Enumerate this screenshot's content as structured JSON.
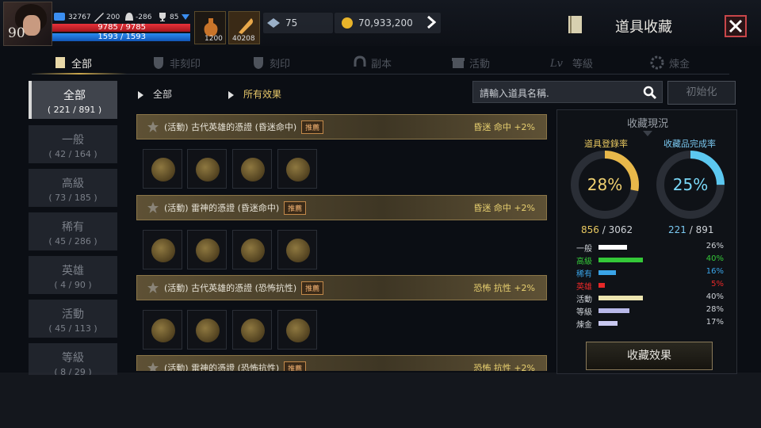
{
  "header": {
    "level": "90",
    "hp": "9785 / 9785",
    "mp": "1593 / 1593",
    "power": "32767",
    "stat_a": "200",
    "stat_b": "-286",
    "stat_c": "85",
    "potion_count": "1200",
    "item_count": "40208",
    "gem": "75",
    "gold": "70,933,200",
    "title": "道具收藏"
  },
  "tabs": [
    {
      "label": "全部"
    },
    {
      "label": "非刻印"
    },
    {
      "label": "刻印"
    },
    {
      "label": "副本"
    },
    {
      "label": "活動"
    },
    {
      "label": "等級"
    },
    {
      "label": "煉金"
    }
  ],
  "categories": [
    {
      "label": "全部",
      "count": "( 221 / 891 )"
    },
    {
      "label": "一般",
      "count": "( 42 / 164 )"
    },
    {
      "label": "高級",
      "count": "( 73 / 185 )"
    },
    {
      "label": "稀有",
      "count": "( 45 / 286 )"
    },
    {
      "label": "英雄",
      "count": "( 4 / 90 )"
    },
    {
      "label": "活動",
      "count": "( 45 / 113 )"
    },
    {
      "label": "等級",
      "count": "( 8 / 29 )"
    }
  ],
  "breadcrumb": {
    "first": "全部",
    "second": "所有效果"
  },
  "search": {
    "placeholder": "請輸入道具名稱."
  },
  "init_label": "初始化",
  "rows": [
    {
      "name": "(活動) 古代英雄的憑證 (昏迷命中)",
      "badge": "推薦",
      "effect": "昏迷 命中 +2%"
    },
    {
      "name": "(活動) 雷神的憑證 (昏迷命中)",
      "badge": "推薦",
      "effect": "昏迷 命中 +2%"
    },
    {
      "name": "(活動) 古代英雄的憑證 (恐怖抗性)",
      "badge": "推薦",
      "effect": "恐怖 抗性 +2%"
    },
    {
      "name": "(活動) 雷神的憑證 (恐怖抗性)",
      "badge": "推薦",
      "effect": "恐怖 抗性 +2%"
    }
  ],
  "panel": {
    "title": "收藏現況",
    "ring1": {
      "label": "道具登錄率",
      "pct": "28%",
      "value": 0.28,
      "count": "856",
      "total": "/ 3062",
      "color": "#e8b84a"
    },
    "ring2": {
      "label": "收藏品完成率",
      "pct": "25%",
      "value": 0.25,
      "count": "221",
      "total": "/ 891",
      "color": "#5cc8f0"
    },
    "stats": [
      {
        "label": "一般",
        "pct": "26%",
        "value": 0.26,
        "color": "#ffffff"
      },
      {
        "label": "高級",
        "pct": "40%",
        "value": 0.4,
        "color": "#34c838"
      },
      {
        "label": "稀有",
        "pct": "16%",
        "value": 0.16,
        "color": "#3aa4e8"
      },
      {
        "label": "英雄",
        "pct": "5%",
        "value": 0.05,
        "color": "#e82828"
      },
      {
        "label": "活動",
        "pct": "40%",
        "value": 0.4,
        "color": "#ece4b0"
      },
      {
        "label": "等級",
        "pct": "28%",
        "value": 0.28,
        "color": "#b8b8e8"
      },
      {
        "label": "煉金",
        "pct": "17%",
        "value": 0.17,
        "color": "#c8c8f0"
      }
    ],
    "button": "收藏效果"
  }
}
